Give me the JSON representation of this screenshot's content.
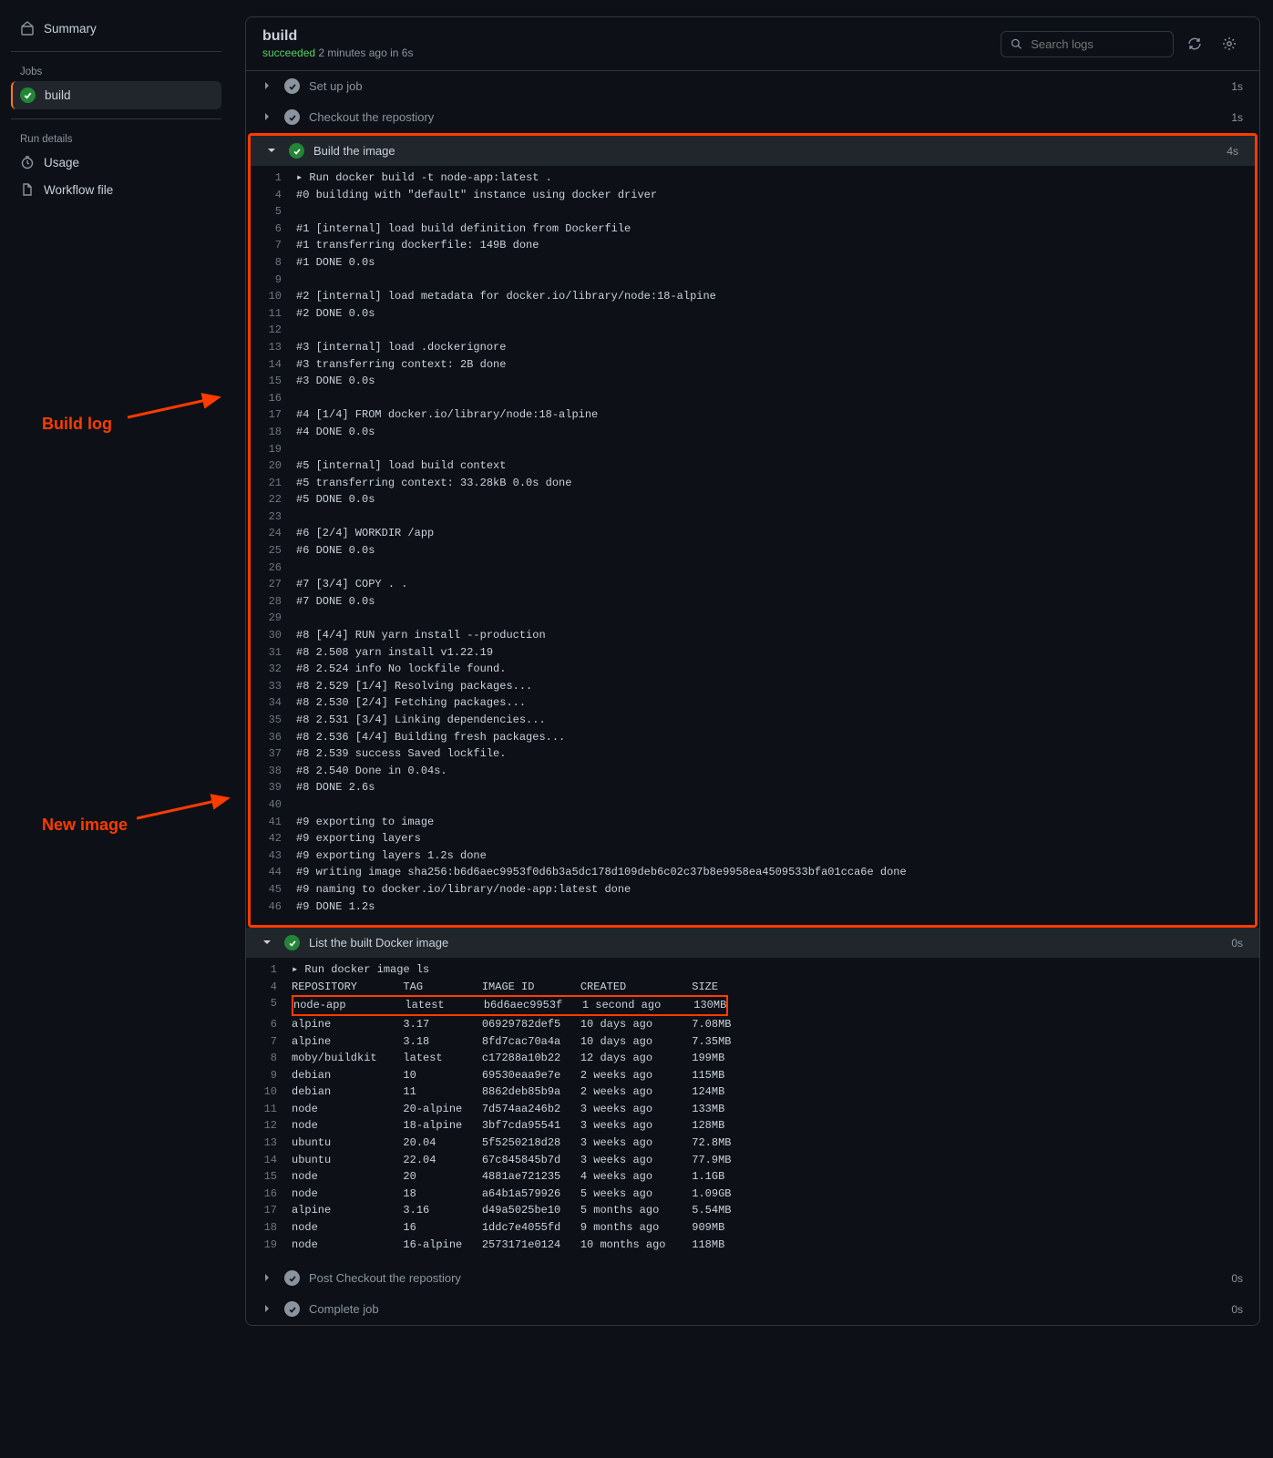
{
  "sidebar": {
    "summary": "Summary",
    "jobs_head": "Jobs",
    "job_name": "build",
    "run_details_head": "Run details",
    "usage": "Usage",
    "workflow_file": "Workflow file"
  },
  "header": {
    "title": "build",
    "status_prefix": "succeeded",
    "status_suffix": " 2 minutes ago in 6s",
    "search_placeholder": "Search logs"
  },
  "steps": {
    "setup": {
      "name": "Set up job",
      "dur": "1s"
    },
    "checkout": {
      "name": "Checkout the repostiory",
      "dur": "1s"
    },
    "build": {
      "name": "Build the image",
      "dur": "4s",
      "lines": [
        {
          "n": "1",
          "t": "▸ Run docker build -t node-app:latest ."
        },
        {
          "n": "4",
          "t": "#0 building with \"default\" instance using docker driver"
        },
        {
          "n": "5",
          "t": ""
        },
        {
          "n": "6",
          "t": "#1 [internal] load build definition from Dockerfile"
        },
        {
          "n": "7",
          "t": "#1 transferring dockerfile: 149B done"
        },
        {
          "n": "8",
          "t": "#1 DONE 0.0s"
        },
        {
          "n": "9",
          "t": ""
        },
        {
          "n": "10",
          "t": "#2 [internal] load metadata for docker.io/library/node:18-alpine"
        },
        {
          "n": "11",
          "t": "#2 DONE 0.0s"
        },
        {
          "n": "12",
          "t": ""
        },
        {
          "n": "13",
          "t": "#3 [internal] load .dockerignore"
        },
        {
          "n": "14",
          "t": "#3 transferring context: 2B done"
        },
        {
          "n": "15",
          "t": "#3 DONE 0.0s"
        },
        {
          "n": "16",
          "t": ""
        },
        {
          "n": "17",
          "t": "#4 [1/4] FROM docker.io/library/node:18-alpine"
        },
        {
          "n": "18",
          "t": "#4 DONE 0.0s"
        },
        {
          "n": "19",
          "t": ""
        },
        {
          "n": "20",
          "t": "#5 [internal] load build context"
        },
        {
          "n": "21",
          "t": "#5 transferring context: 33.28kB 0.0s done"
        },
        {
          "n": "22",
          "t": "#5 DONE 0.0s"
        },
        {
          "n": "23",
          "t": ""
        },
        {
          "n": "24",
          "t": "#6 [2/4] WORKDIR /app"
        },
        {
          "n": "25",
          "t": "#6 DONE 0.0s"
        },
        {
          "n": "26",
          "t": ""
        },
        {
          "n": "27",
          "t": "#7 [3/4] COPY . ."
        },
        {
          "n": "28",
          "t": "#7 DONE 0.0s"
        },
        {
          "n": "29",
          "t": ""
        },
        {
          "n": "30",
          "t": "#8 [4/4] RUN yarn install --production"
        },
        {
          "n": "31",
          "t": "#8 2.508 yarn install v1.22.19"
        },
        {
          "n": "32",
          "t": "#8 2.524 info No lockfile found."
        },
        {
          "n": "33",
          "t": "#8 2.529 [1/4] Resolving packages..."
        },
        {
          "n": "34",
          "t": "#8 2.530 [2/4] Fetching packages..."
        },
        {
          "n": "35",
          "t": "#8 2.531 [3/4] Linking dependencies..."
        },
        {
          "n": "36",
          "t": "#8 2.536 [4/4] Building fresh packages..."
        },
        {
          "n": "37",
          "t": "#8 2.539 success Saved lockfile."
        },
        {
          "n": "38",
          "t": "#8 2.540 Done in 0.04s."
        },
        {
          "n": "39",
          "t": "#8 DONE 2.6s"
        },
        {
          "n": "40",
          "t": ""
        },
        {
          "n": "41",
          "t": "#9 exporting to image"
        },
        {
          "n": "42",
          "t": "#9 exporting layers"
        },
        {
          "n": "43",
          "t": "#9 exporting layers 1.2s done"
        },
        {
          "n": "44",
          "t": "#9 writing image sha256:b6d6aec9953f0d6b3a5dc178d109deb6c02c37b8e9958ea4509533bfa01cca6e done"
        },
        {
          "n": "45",
          "t": "#9 naming to docker.io/library/node-app:latest done"
        },
        {
          "n": "46",
          "t": "#9 DONE 1.2s"
        }
      ]
    },
    "list": {
      "name": "List the built Docker image",
      "dur": "0s",
      "lines": [
        {
          "n": "1",
          "t": "▸ Run docker image ls"
        },
        {
          "n": "4",
          "t": "REPOSITORY       TAG         IMAGE ID       CREATED          SIZE"
        },
        {
          "n": "5",
          "t": "node-app         latest      b6d6aec9953f   1 second ago     130MB",
          "hl": true
        },
        {
          "n": "6",
          "t": "alpine           3.17        06929782def5   10 days ago      7.08MB"
        },
        {
          "n": "7",
          "t": "alpine           3.18        8fd7cac70a4a   10 days ago      7.35MB"
        },
        {
          "n": "8",
          "t": "moby/buildkit    latest      c17288a10b22   12 days ago      199MB"
        },
        {
          "n": "9",
          "t": "debian           10          69530eaa9e7e   2 weeks ago      115MB"
        },
        {
          "n": "10",
          "t": "debian           11          8862deb85b9a   2 weeks ago      124MB"
        },
        {
          "n": "11",
          "t": "node             20-alpine   7d574aa246b2   3 weeks ago      133MB"
        },
        {
          "n": "12",
          "t": "node             18-alpine   3bf7cda95541   3 weeks ago      128MB"
        },
        {
          "n": "13",
          "t": "ubuntu           20.04       5f5250218d28   3 weeks ago      72.8MB"
        },
        {
          "n": "14",
          "t": "ubuntu           22.04       67c845845b7d   3 weeks ago      77.9MB"
        },
        {
          "n": "15",
          "t": "node             20          4881ae721235   4 weeks ago      1.1GB"
        },
        {
          "n": "16",
          "t": "node             18          a64b1a579926   5 weeks ago      1.09GB"
        },
        {
          "n": "17",
          "t": "alpine           3.16        d49a5025be10   5 months ago     5.54MB"
        },
        {
          "n": "18",
          "t": "node             16          1ddc7e4055fd   9 months ago     909MB"
        },
        {
          "n": "19",
          "t": "node             16-alpine   2573171e0124   10 months ago    118MB"
        }
      ]
    },
    "post_checkout": {
      "name": "Post Checkout the repostiory",
      "dur": "0s"
    },
    "complete": {
      "name": "Complete job",
      "dur": "0s"
    }
  },
  "annot": {
    "build_log": "Build log",
    "new_image": "New image"
  }
}
